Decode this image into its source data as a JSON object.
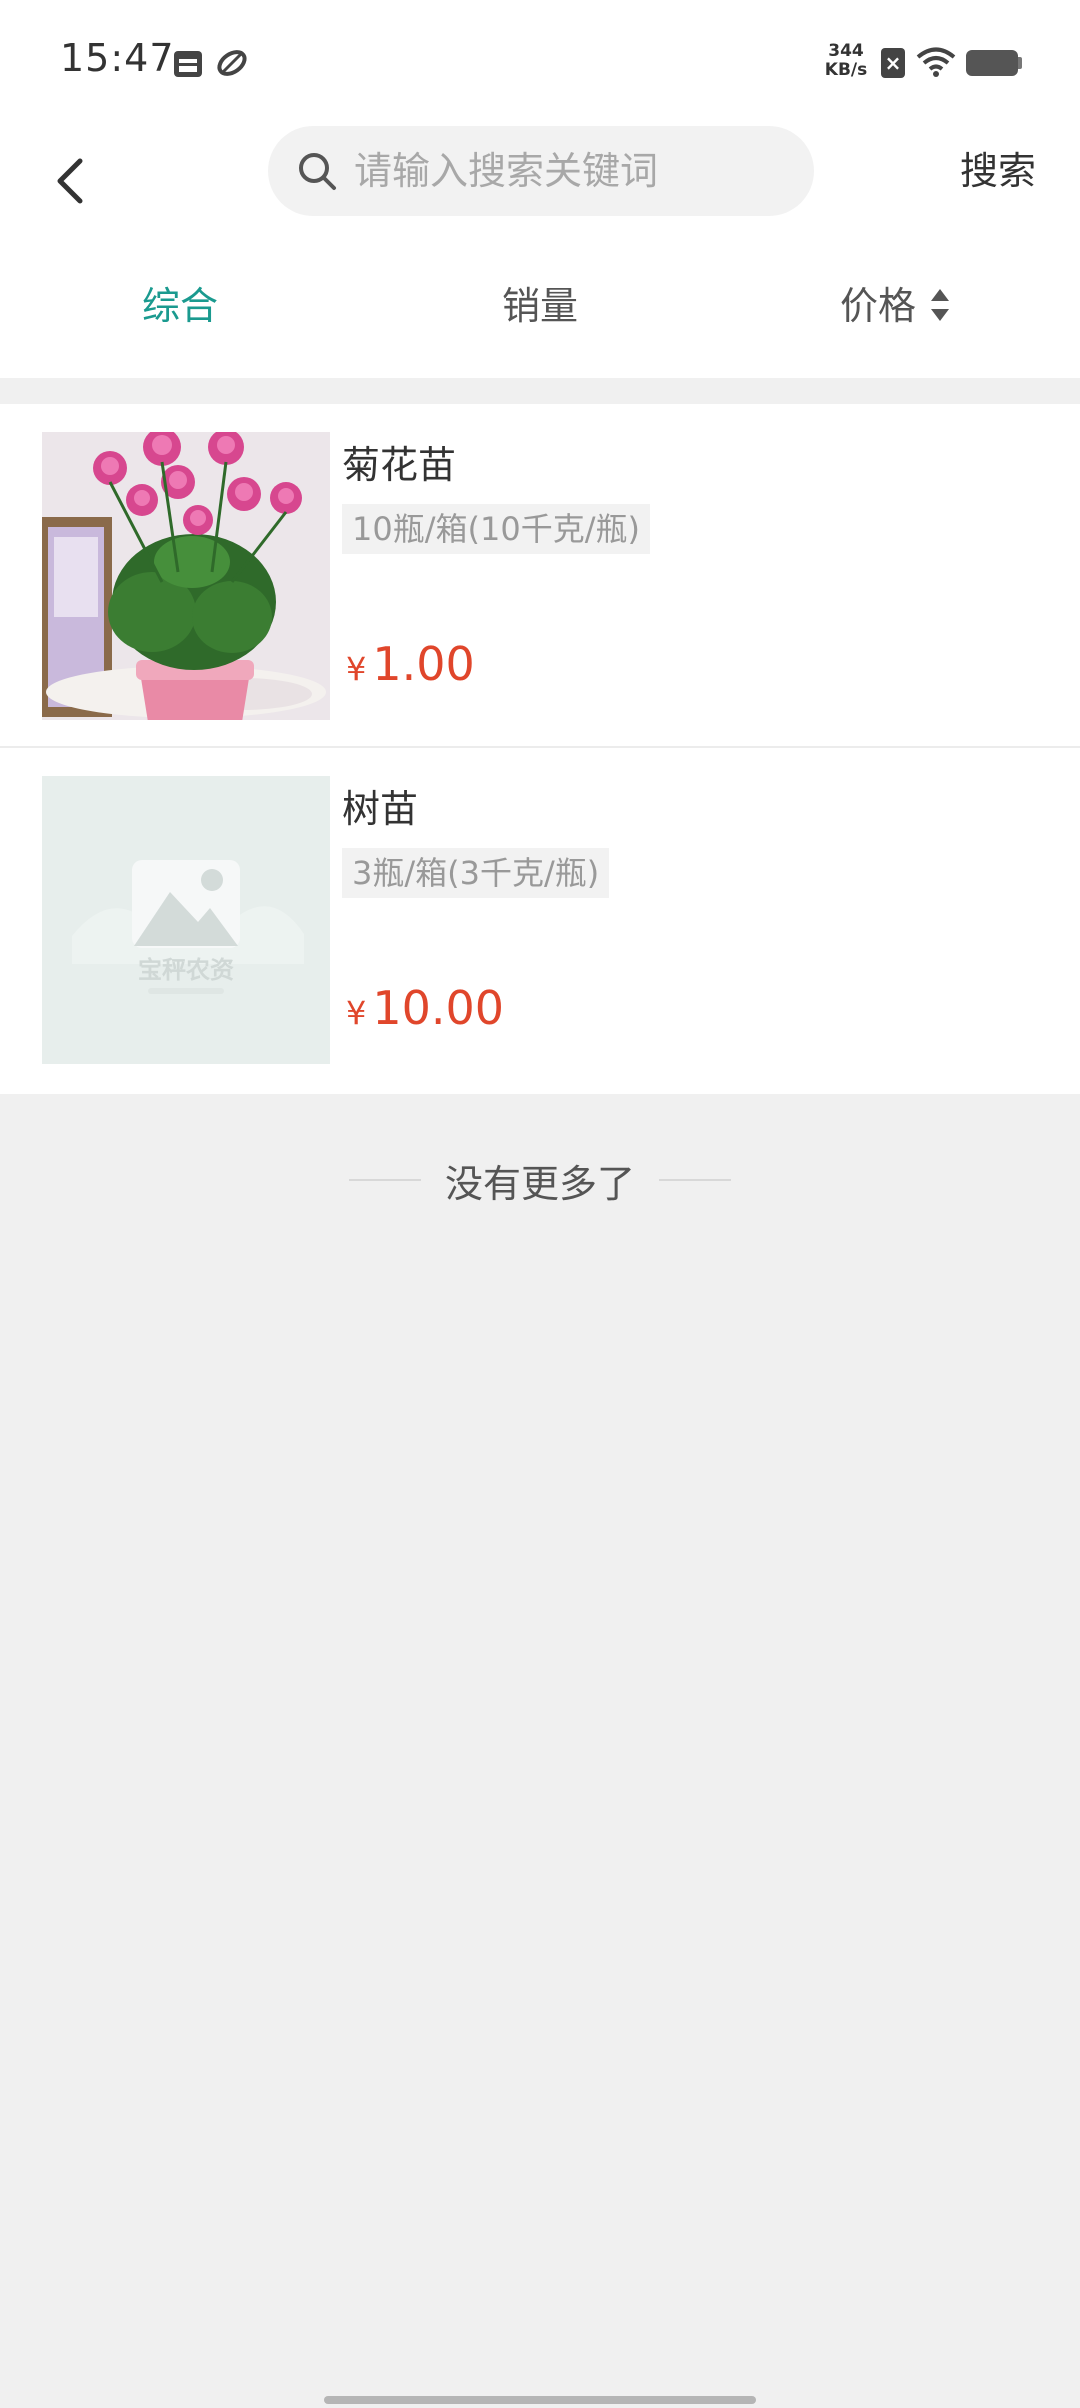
{
  "status_bar": {
    "time": "15:47",
    "net_speed_value": "344",
    "net_speed_unit": "KB/s",
    "icons": [
      "calendar-icon",
      "sync-icon",
      "sim-blocked-icon",
      "wifi-icon",
      "battery-icon"
    ]
  },
  "header": {
    "back_icon": "chevron-left-icon",
    "search_placeholder": "请输入搜索关键词",
    "search_value": "",
    "search_button": "搜索"
  },
  "tabs": [
    {
      "label": "综合",
      "active": true
    },
    {
      "label": "销量",
      "active": false
    },
    {
      "label": "价格",
      "active": false,
      "sort_icon": "sort-updown-icon"
    }
  ],
  "products": [
    {
      "name": "菊花苗",
      "spec": "10瓶/箱(10千克/瓶)",
      "currency": "¥",
      "price": "1.00",
      "image": "chrysanthemum-photo"
    },
    {
      "name": "树苗",
      "spec": "3瓶/箱(3千克/瓶)",
      "currency": "¥",
      "price": "10.00",
      "image": "placeholder-image",
      "placeholder_brand": "宝秤农资"
    }
  ],
  "footer": {
    "no_more": "没有更多了"
  },
  "colors": {
    "accent": "#1a9a8f",
    "price": "#e0462b",
    "background": "#f0f0f0"
  }
}
